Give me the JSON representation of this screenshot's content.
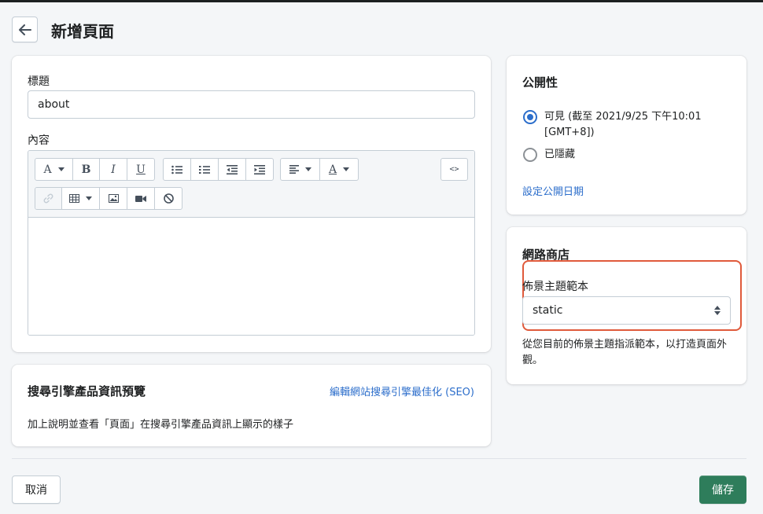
{
  "header": {
    "title": "新增頁面",
    "back_icon": "arrow-left-icon"
  },
  "main": {
    "title_label": "標題",
    "title_value": "about",
    "content_label": "內容",
    "toolbar": {
      "font_btn": "A",
      "bold_btn": "B",
      "italic_btn": "I",
      "underline_btn": "U",
      "color_btn": "A",
      "code_btn": "<>"
    }
  },
  "seo": {
    "title": "搜尋引擎產品資訊預覽",
    "edit_link": "編輯網站搜尋引擎最佳化 (SEO)",
    "description": "加上說明並查看「頁面」在搜尋引擎產品資訊上顯示的樣子"
  },
  "visibility": {
    "title": "公開性",
    "options": [
      {
        "label_line1": "可見 (截至 2021/9/25 下午10:01",
        "label_line2": "[GMT+8])",
        "selected": true
      },
      {
        "label_line1": "已隱藏",
        "selected": false
      }
    ],
    "schedule_link": "設定公開日期"
  },
  "store": {
    "title": "網路商店",
    "template_label": "佈景主題範本",
    "template_value": "static",
    "help_text": "從您目前的佈景主題指派範本，以打造頁面外觀。"
  },
  "footer": {
    "cancel_label": "取消",
    "save_label": "儲存"
  },
  "colors": {
    "accent": "#2c6ecb",
    "primary_button": "#2e7d5b",
    "highlight_border": "#e05a3b"
  }
}
